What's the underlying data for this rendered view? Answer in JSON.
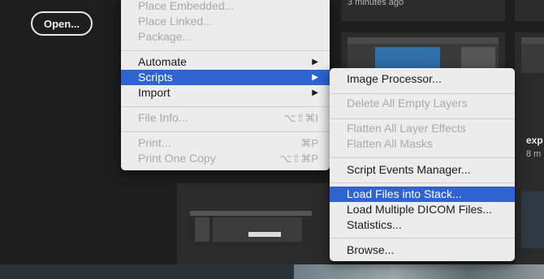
{
  "home": {
    "open_button": "Open...",
    "recent": [
      {
        "time": "3 minutes ago"
      },
      {
        "name": "exp",
        "time": "8 m"
      }
    ]
  },
  "main_menu": {
    "items": [
      {
        "label": "Place Embedded...",
        "enabled": false
      },
      {
        "label": "Place Linked...",
        "enabled": false
      },
      {
        "label": "Package...",
        "enabled": false
      },
      {
        "label": "Automate",
        "enabled": true,
        "submenu": true
      },
      {
        "label": "Scripts",
        "enabled": true,
        "submenu": true,
        "selected": true
      },
      {
        "label": "Import",
        "enabled": true,
        "submenu": true
      },
      {
        "label": "File Info...",
        "enabled": false,
        "shortcut": "⌥⇧⌘I"
      },
      {
        "label": "Print...",
        "enabled": false,
        "shortcut": "⌘P"
      },
      {
        "label": "Print One Copy",
        "enabled": false,
        "shortcut": "⌥⇧⌘P"
      }
    ],
    "submenu_arrow": "▶"
  },
  "scripts_menu": {
    "items": [
      {
        "label": "Image Processor...",
        "enabled": true
      },
      {
        "label": "Delete All Empty Layers",
        "enabled": false
      },
      {
        "label": "Flatten All Layer Effects",
        "enabled": false
      },
      {
        "label": "Flatten All Masks",
        "enabled": false
      },
      {
        "label": "Script Events Manager...",
        "enabled": true
      },
      {
        "label": "Load Files into Stack...",
        "enabled": true,
        "selected": true
      },
      {
        "label": "Load Multiple DICOM Files...",
        "enabled": true
      },
      {
        "label": "Statistics...",
        "enabled": true
      },
      {
        "label": "Browse...",
        "enabled": true
      }
    ]
  },
  "colors": {
    "selection": "#2f63d0",
    "menu_bg": "#ececec",
    "app_bg": "#1e1e1e"
  }
}
